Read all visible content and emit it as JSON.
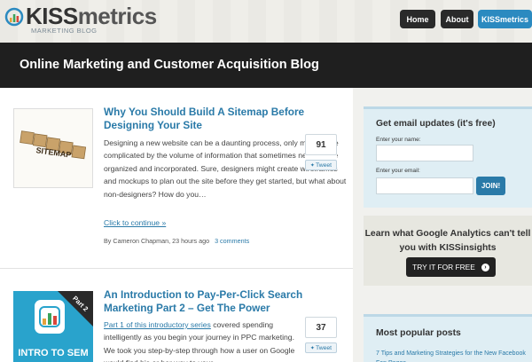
{
  "header": {
    "logo_text_kiss": "KISS",
    "logo_text_metrics": "metrics",
    "logo_tagline": "MARKETING BLOG",
    "nav": [
      {
        "label": "Home"
      },
      {
        "label": "About"
      },
      {
        "label": "KISSmetrics"
      }
    ]
  },
  "banner": {
    "title": "Online Marketing and Customer Acquisition Blog"
  },
  "posts": [
    {
      "title": "Why You Should Build A Sitemap Before Designing Your Site",
      "thumb_text": "SITEMAP",
      "excerpt": "Designing a new website can be a daunting process, only made more complicated by the volume of information that sometimes needs to be organized and incorporated. Sure, designers might create wireframes and mockups to plan out the site before they get started, but what about non-designers? How do you…",
      "continue_label": "Click to continue »",
      "byline": "By Cameron Chapman, 23 hours ago",
      "comments": "3 comments",
      "share_count": "91",
      "tweet_label": "Tweet"
    },
    {
      "title": "An Introduction to Pay-Per-Click Search Marketing Part 2 – Get The Power",
      "thumb_text": "INTRO TO SEM",
      "thumb_badge": "Part 2",
      "excerpt_link": "Part 1 of this introductory series",
      "excerpt": " covered spending intelligently as you begin your journey in PPC marketing. We took you step-by-step through how a user on Google would find his or her way to your",
      "share_count": "37",
      "tweet_label": "Tweet"
    }
  ],
  "sidebar": {
    "email": {
      "title": "Get email updates (it's free)",
      "name_label": "Enter your name:",
      "email_label": "Enter your email:",
      "join_label": "JOIN!"
    },
    "ga": {
      "text": "Learn what Google Analytics can't tell you with KISSinsights",
      "button_label": "TRY IT FOR FREE"
    },
    "popular": {
      "title": "Most popular posts",
      "first_item": "7 Tips and Marketing Strategies for the New Facebook Fan Pages"
    }
  },
  "colors": {
    "accent": "#2a7aa8",
    "dark": "#1f1f1f"
  }
}
